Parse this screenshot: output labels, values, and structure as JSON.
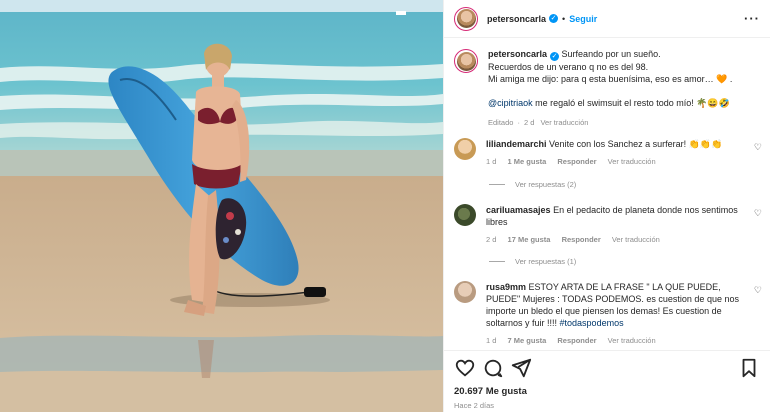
{
  "post": {
    "username": "petersoncarla",
    "follow_label": "Seguir",
    "more_icon": "more-horizontal-icon",
    "caption": {
      "line1": "Surfeando por un sueño.",
      "line2": "Recuerdos de un verano q no es del 98.",
      "line3": "Mi amiga me dijo: para q esta buenísima, eso es amor…",
      "line3_emoji": "🧡",
      "line3_end": ".",
      "mention": "@cipitriaok",
      "line4_rest": " me regaló el swimsuit el resto todo mío! 🌴😄🤣",
      "meta_edited": "Editado",
      "meta_time": "2 d",
      "meta_translate": "Ver traducción"
    },
    "likes": "20.697 Me gusta",
    "ago": "Hace 2 días"
  },
  "comments": [
    {
      "username": "liliandemarchi",
      "text": "Venite con los Sanchez a surferar! 👏👏👏",
      "time": "1 d",
      "likes": "1 Me gusta",
      "reply": "Responder",
      "translate": "Ver traducción",
      "replies": "Ver respuestas (2)"
    },
    {
      "username": "cariluamasajes",
      "text": "En el pedacito de planeta donde nos sentimos libres",
      "time": "2 d",
      "likes": "17 Me gusta",
      "reply": "Responder",
      "translate": "Ver traducción",
      "replies": "Ver respuestas (1)"
    },
    {
      "username": "rusa9mm",
      "text": "ESTOY ARTA DE LA FRASE \" LA QUE PUEDE, PUEDE\" Mujeres : TODAS PODEMOS. es cuestion de que nos importe un bledo el que piensen los demas! Es cuestion de soltarnos y fuir !!!! ",
      "hashtag": "#todaspodemos",
      "time": "1 d",
      "likes": "7 Me gusta",
      "reply": "Responder",
      "translate": "Ver traducción"
    }
  ],
  "icons": {
    "like": "heart-icon",
    "comment": "comment-icon",
    "share": "send-icon",
    "save": "bookmark-icon"
  },
  "colors": {
    "accent": "#0095f6",
    "text": "#262626",
    "muted": "#8e8e8e"
  }
}
